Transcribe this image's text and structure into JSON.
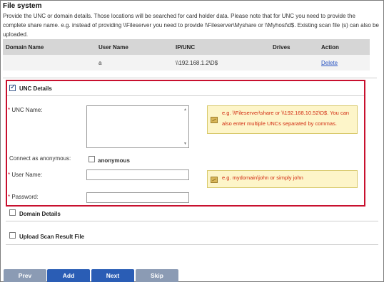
{
  "page": {
    "title": "File system",
    "description": "Provide the UNC or domain details. Those locations will be searched for card holder data. Please note that for UNC you need to provide the complete share name. e.g. instead of providing \\\\Fileserver you need to provide \\\\Fileserver\\Myshare or \\\\Myhost\\d$. Existing scan file (s) can also be uploaded."
  },
  "table": {
    "headers": [
      "Domain Name",
      "User Name",
      "IP/UNC",
      "Drives",
      "Action"
    ],
    "rows": [
      {
        "domain": "",
        "user": "a",
        "unc": "\\\\192.168.1.2\\D$",
        "drives": "",
        "action": "Delete"
      }
    ]
  },
  "unc_details": {
    "label": "UNC Details",
    "checked": true,
    "unc_name_label": "UNC Name:",
    "unc_name_value": "",
    "unc_hint": "e.g. \\\\Fileserver\\share or \\\\192.168.10.52\\D$. You can also enter multiple UNCs separated by commas.",
    "anonymous_label": "Connect as anonymous:",
    "anonymous_checkbox_label": "anonymous",
    "anonymous_checked": false,
    "username_label": "User Name:",
    "username_value": "",
    "username_hint": "e.g. mydomain\\john or simply john",
    "password_label": "Password:",
    "password_value": "",
    "required_marker": "*"
  },
  "domain_details": {
    "label": "Domain Details",
    "checked": false
  },
  "upload_scan": {
    "label": "Upload Scan Result File",
    "checked": false
  },
  "buttons": {
    "prev": "Prev",
    "add": "Add",
    "next": "Next",
    "skip": "Skip"
  }
}
